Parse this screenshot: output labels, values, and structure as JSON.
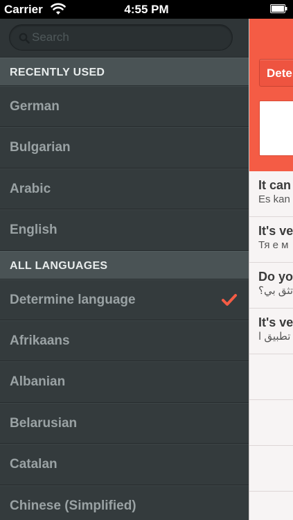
{
  "status_bar": {
    "carrier": "Carrier",
    "time": "4:55 PM"
  },
  "sidebar": {
    "search": {
      "placeholder": "Search",
      "value": ""
    },
    "recent_header": "RECENTLY USED",
    "recent": [
      "German",
      "Bulgarian",
      "Arabic",
      "English"
    ],
    "all_header": "ALL LANGUAGES",
    "all": [
      "Determine language",
      "Afrikaans",
      "Albanian",
      "Belarusian",
      "Catalan",
      "Chinese (Simplified)"
    ],
    "selected": "Determine language"
  },
  "main": {
    "language_button": "Dete",
    "history": [
      {
        "source": "It can",
        "translation": "Es kan"
      },
      {
        "source": "It's ve",
        "translation": "Тя е м"
      },
      {
        "source": "Do yo",
        "translation": "تثق بي؟"
      },
      {
        "source": "It's ve",
        "translation": "تطبيق ا"
      }
    ]
  },
  "colors": {
    "accent": "#f45c45",
    "sidebar_bg": "#343b3d",
    "section_header_bg": "#4a5355",
    "checkmark": "#f45c45"
  }
}
